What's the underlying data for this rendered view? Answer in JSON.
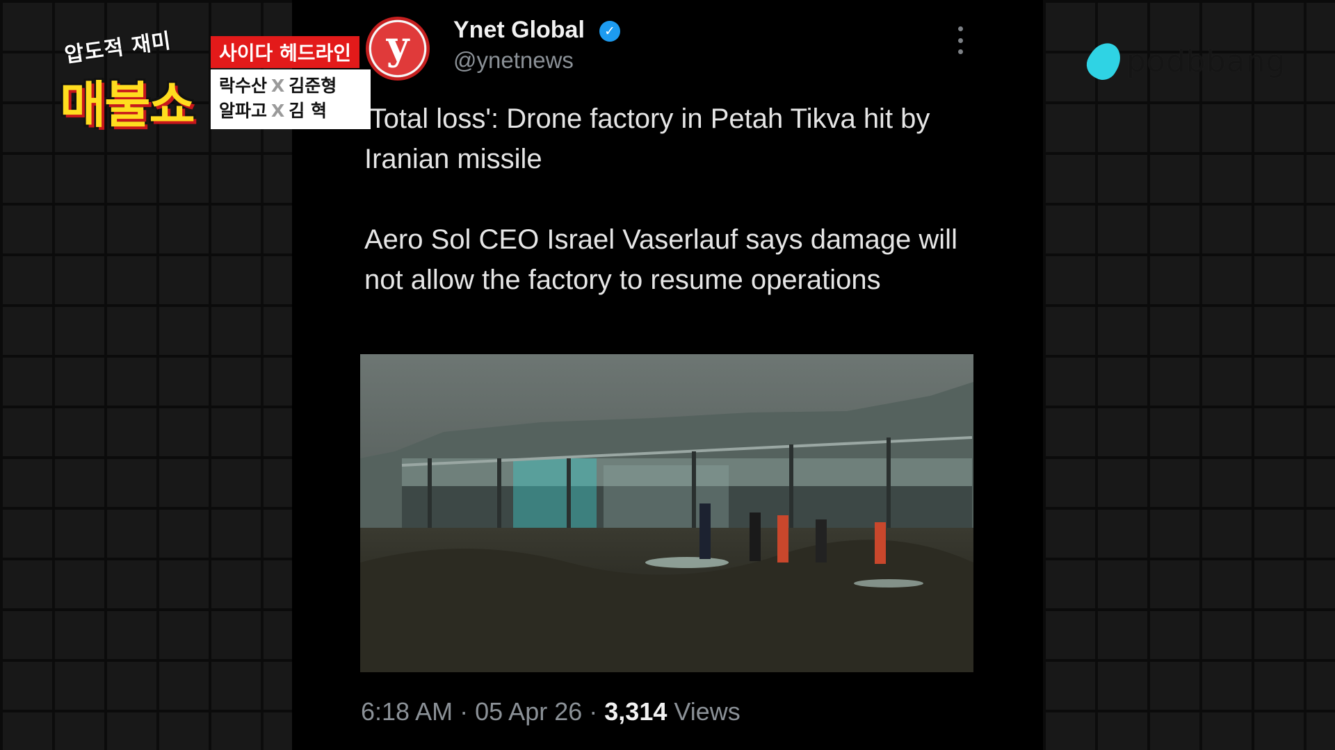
{
  "overlay": {
    "show_subtitle": "압도적 재미",
    "show_title": "매불쇼",
    "segment_tag": "사이다 헤드라인",
    "guests": [
      {
        "left": "락수산",
        "sep": "X",
        "right": "김준형"
      },
      {
        "left": "알파고",
        "sep": "X",
        "right": "김 혁"
      }
    ],
    "brand_wordmark": "podbbang",
    "colors": {
      "tag_red": "#e31a1a",
      "title_yellow": "#ffdd1f",
      "podbbang_cyan": "#2fd3e4"
    }
  },
  "tweet": {
    "avatar_letter": "y",
    "display_name": "Ynet Global",
    "verified_icon": "verified-badge-icon",
    "handle": "@ynetnews",
    "more_icon": "more-options-icon",
    "paragraphs": [
      "'Total loss': Drone factory in Petah Tikva hit by Iranian missile",
      "Aero Sol CEO Israel Vaserlauf says damage will not allow the factory to resume operations"
    ],
    "media_description_icon": "photo-destroyed-factory",
    "time": "6:18 AM",
    "date": "05 Apr 26",
    "separator": "·",
    "views_count": "3,314",
    "views_label": "Views"
  }
}
